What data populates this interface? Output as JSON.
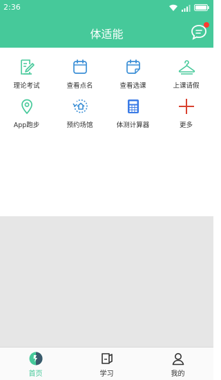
{
  "status_bar": {
    "time": "2:36"
  },
  "header": {
    "title": "体适能",
    "has_unread": true
  },
  "colors": {
    "brand": "#46c99a",
    "badge": "#ff3b30",
    "calculator": "#3b7be6",
    "plus": "#d9412f"
  },
  "features": [
    {
      "label": "理论考试",
      "icon": "exam-edit-icon"
    },
    {
      "label": "查看点名",
      "icon": "roll-call-calendar-icon"
    },
    {
      "label": "查看选课",
      "icon": "course-selection-calendar-icon"
    },
    {
      "label": "上课请假",
      "icon": "leave-hanger-icon"
    },
    {
      "label": "App跑步",
      "icon": "location-pin-icon"
    },
    {
      "label": "预约场馆",
      "icon": "venue-booking-icon"
    },
    {
      "label": "体测计算器",
      "icon": "calculator-icon"
    },
    {
      "label": "更多",
      "icon": "plus-icon"
    }
  ],
  "tabs": [
    {
      "label": "首页",
      "icon": "home-icon",
      "active": true
    },
    {
      "label": "学习",
      "icon": "study-icon",
      "active": false
    },
    {
      "label": "我的",
      "icon": "user-icon",
      "active": false
    }
  ]
}
